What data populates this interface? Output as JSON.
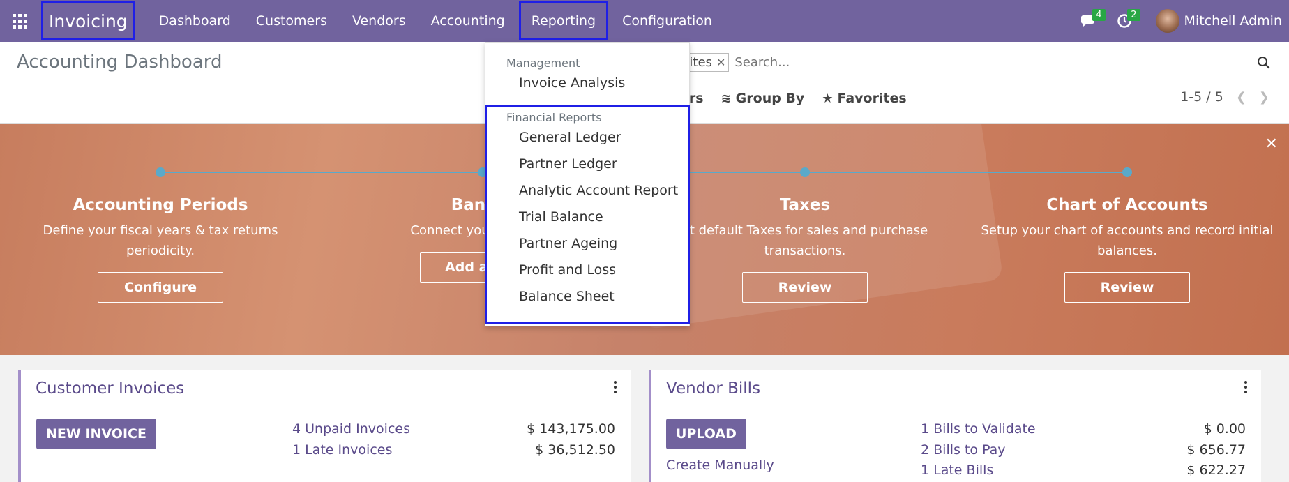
{
  "navbar": {
    "brand": "Invoicing",
    "menu": [
      "Dashboard",
      "Customers",
      "Vendors",
      "Accounting",
      "Reporting",
      "Configuration"
    ],
    "messages_badge": "4",
    "activity_badge": "2",
    "user": "Mitchell Admin"
  },
  "control_panel": {
    "title": "Accounting Dashboard",
    "facet": "orites",
    "search_placeholder": "Search...",
    "filters_label": "ers",
    "group_by_label": "Group By",
    "favorites_label": "Favorites",
    "pager": "1-5 / 5"
  },
  "dropdown": {
    "management_header": "Management",
    "management_items": [
      "Invoice Analysis"
    ],
    "financial_header": "Financial Reports",
    "financial_items": [
      "General Ledger",
      "Partner Ledger",
      "Analytic Account Report",
      "Trial Balance",
      "Partner Ageing",
      "Profit and Loss",
      "Balance Sheet"
    ]
  },
  "banner": {
    "steps": [
      {
        "title": "Accounting Periods",
        "desc": "Define your fiscal years & tax returns periodicity.",
        "button": "Configure"
      },
      {
        "title": "Bank A",
        "desc": "Connect your fina seco",
        "button": "Add a ban"
      },
      {
        "title": "Taxes",
        "desc": "et default Taxes for sales and purchase transactions.",
        "button": "Review"
      },
      {
        "title": "Chart of Accounts",
        "desc": "Setup your chart of accounts and record initial balances.",
        "button": "Review"
      }
    ]
  },
  "cards": {
    "customer": {
      "title": "Customer Invoices",
      "button": "NEW INVOICE",
      "rows": [
        {
          "label": "4 Unpaid Invoices",
          "amount": "$ 143,175.00"
        },
        {
          "label": "1 Late Invoices",
          "amount": "$ 36,512.50"
        }
      ]
    },
    "vendor": {
      "title": "Vendor Bills",
      "button": "UPLOAD",
      "secondary": "Create Manually",
      "rows": [
        {
          "label": "1 Bills to Validate",
          "amount": "$ 0.00"
        },
        {
          "label": "2 Bills to Pay",
          "amount": "$ 656.77"
        },
        {
          "label": "1 Late Bills",
          "amount": "$ 622.27"
        }
      ]
    }
  }
}
